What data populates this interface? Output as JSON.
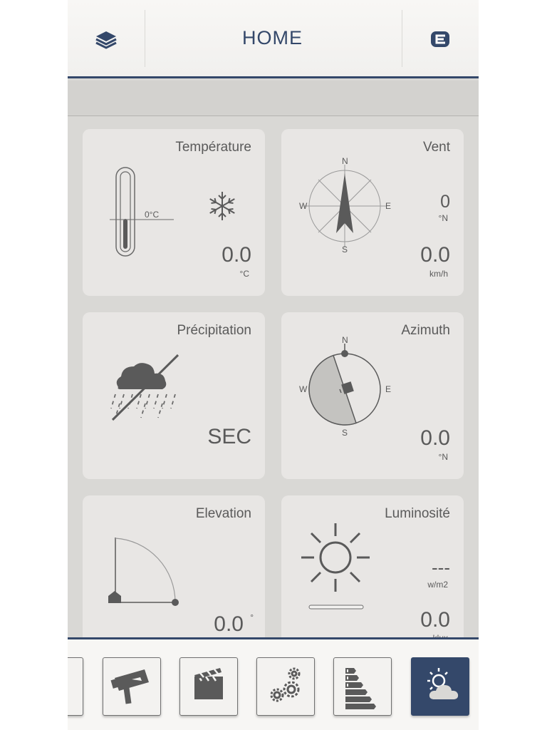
{
  "header": {
    "title": "HOME",
    "left_icon": "layers-icon",
    "right_icon": "logout-icon"
  },
  "cards": {
    "temperature": {
      "title": "Température",
      "scale_label": "0°C",
      "value": "0.0",
      "unit": "°C",
      "icon": "snowflake-icon"
    },
    "wind": {
      "title": "Vent",
      "direction_value": "0",
      "direction_unit": "°N",
      "value": "0.0",
      "unit": "km/h",
      "n": "N",
      "s": "S",
      "e": "E",
      "w": "W"
    },
    "precipitation": {
      "title": "Précipitation",
      "value": "SEC",
      "icon": "rain-crossed-icon"
    },
    "azimuth": {
      "title": "Azimuth",
      "value": "0.0",
      "unit": "°N",
      "n": "N",
      "s": "S",
      "e": "E",
      "w": "W"
    },
    "elevation": {
      "title": "Elevation",
      "value": "0.0",
      "unit": "°"
    },
    "luminosity": {
      "title": "Luminosité",
      "value_wm2": "---",
      "unit_wm2": "w/m2",
      "value": "0.0",
      "unit": "klux",
      "icon": "sun-icon"
    }
  },
  "toolbar": {
    "items": [
      "home-icon",
      "camera-icon",
      "clapperboard-icon",
      "gears-icon",
      "energy-rating-icon",
      "weather-icon"
    ],
    "active": "weather-icon"
  },
  "colors": {
    "accent": "#34486a",
    "card": "#e8e6e4",
    "icon": "#5a5a5a",
    "background": "#d9d8d5"
  }
}
